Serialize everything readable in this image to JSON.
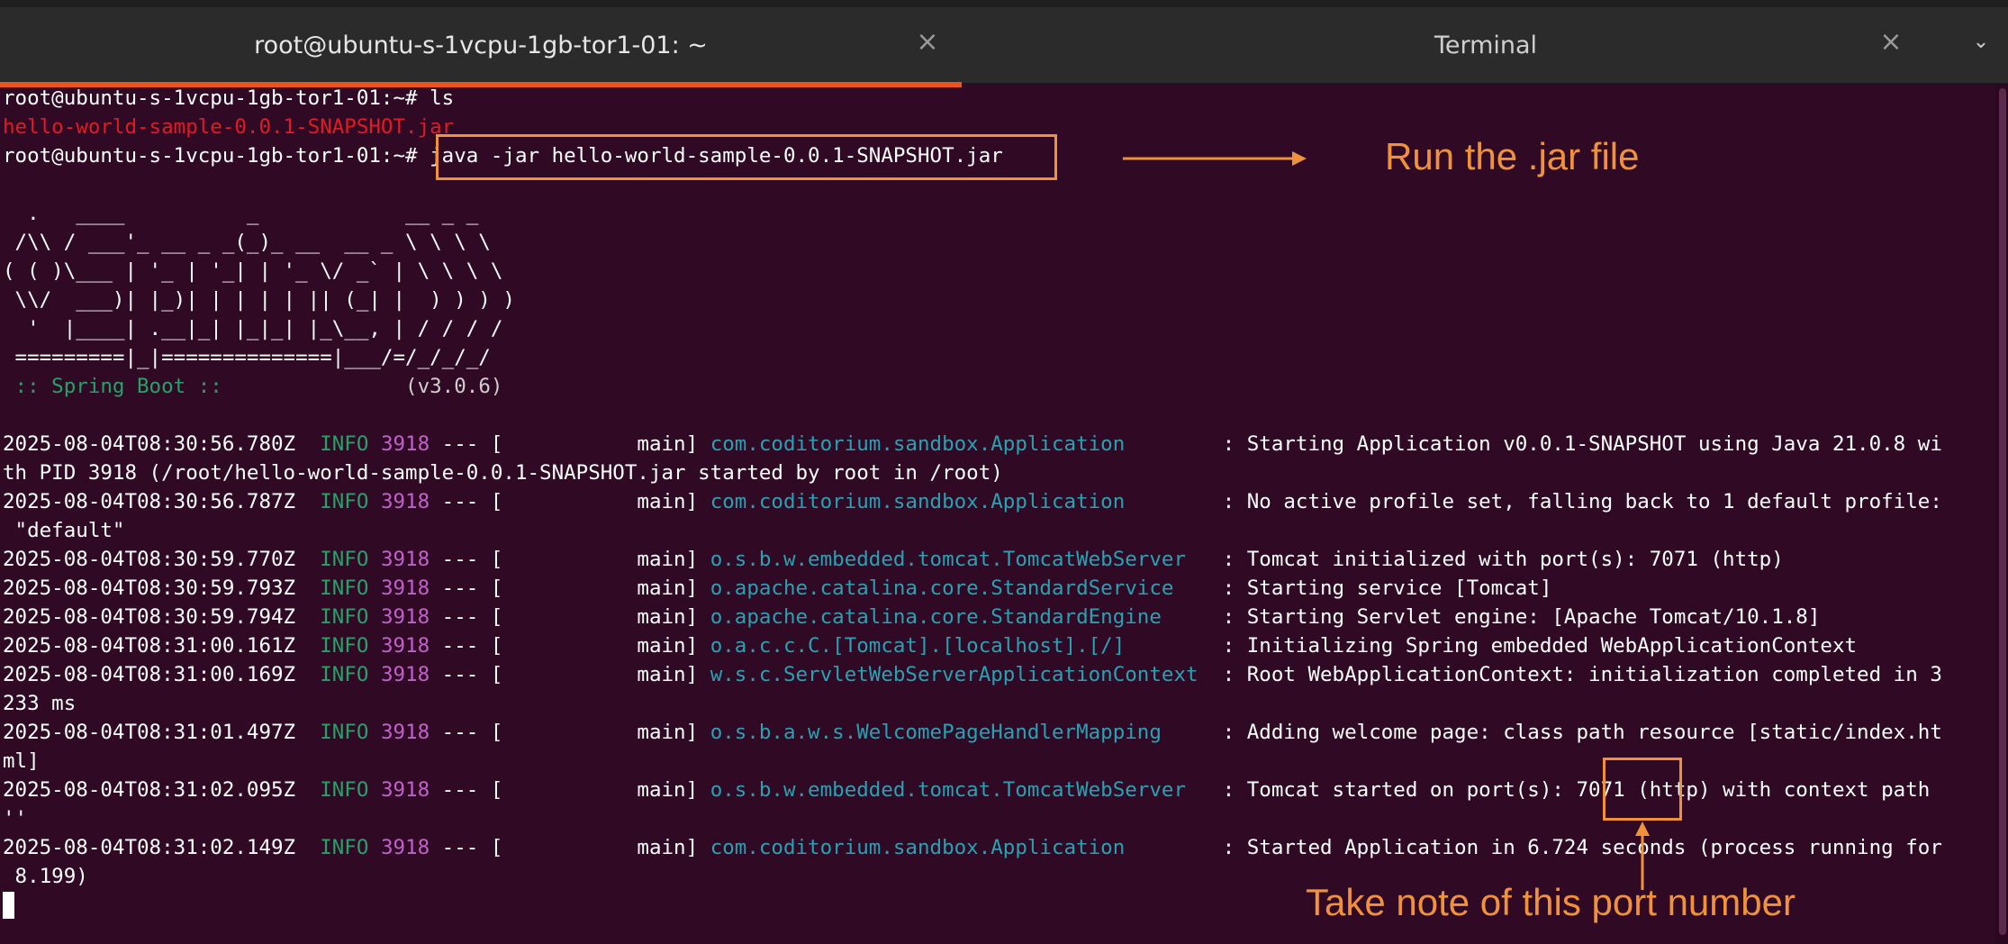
{
  "tabs": [
    {
      "label": "root@ubuntu-s-1vcpu-1gb-tor1-01: ~"
    },
    {
      "label": "Terminal"
    }
  ],
  "icons": {
    "close": "×",
    "menu": "⌄"
  },
  "prompt": "root@ubuntu-s-1vcpu-1gb-tor1-01:~#",
  "cmd1": " ls",
  "ls_output": "hello-world-sample-0.0.1-SNAPSHOT.jar",
  "cmd2": "java -jar hello-world-sample-0.0.1-SNAPSHOT.jar",
  "banner": [
    "  .   ____          _            __ _ _",
    " /\\\\ / ___'_ __ _ _(_)_ __  __ _ \\ \\ \\ \\",
    "( ( )\\___ | '_ | '_| | '_ \\/ _` | \\ \\ \\ \\",
    " \\\\/  ___)| |_)| | | | | || (_| |  ) ) ) )",
    "  '  |____| .__|_| |_|_| |_\\__, | / / / /",
    " =========|_|==============|___/=/_/_/_/"
  ],
  "spring": {
    "label": " :: Spring Boot :: ",
    "version": "              (v3.0.6)"
  },
  "log": {
    "level": "INFO",
    "pid": "3918",
    "sep": " --- [           main] ",
    "entries": [
      {
        "time": "2025-08-04T08:30:56.780Z",
        "logger": "com.coditorium.sandbox.Application       ",
        "msg": " : Starting Application v0.0.1-SNAPSHOT using Java 21.0.8 wi",
        "cont": "th PID 3918 (/root/hello-world-sample-0.0.1-SNAPSHOT.jar started by root in /root)"
      },
      {
        "time": "2025-08-04T08:30:56.787Z",
        "logger": "com.coditorium.sandbox.Application       ",
        "msg": " : No active profile set, falling back to 1 default profile:",
        "cont": " \"default\""
      },
      {
        "time": "2025-08-04T08:30:59.770Z",
        "logger": "o.s.b.w.embedded.tomcat.TomcatWebServer  ",
        "msg": " : Tomcat initialized with port(s): 7071 (http)",
        "cont": ""
      },
      {
        "time": "2025-08-04T08:30:59.793Z",
        "logger": "o.apache.catalina.core.StandardService   ",
        "msg": " : Starting service [Tomcat]",
        "cont": ""
      },
      {
        "time": "2025-08-04T08:30:59.794Z",
        "logger": "o.apache.catalina.core.StandardEngine    ",
        "msg": " : Starting Servlet engine: [Apache Tomcat/10.1.8]",
        "cont": ""
      },
      {
        "time": "2025-08-04T08:31:00.161Z",
        "logger": "o.a.c.c.C.[Tomcat].[localhost].[/]       ",
        "msg": " : Initializing Spring embedded WebApplicationContext",
        "cont": ""
      },
      {
        "time": "2025-08-04T08:31:00.169Z",
        "logger": "w.s.c.ServletWebServerApplicationContext ",
        "msg": " : Root WebApplicationContext: initialization completed in 3",
        "cont": "233 ms"
      },
      {
        "time": "2025-08-04T08:31:01.497Z",
        "logger": "o.s.b.a.w.s.WelcomePageHandlerMapping    ",
        "msg": " : Adding welcome page: class path resource [static/index.ht",
        "cont": "ml]"
      },
      {
        "time": "2025-08-04T08:31:02.095Z",
        "logger": "o.s.b.w.embedded.tomcat.TomcatWebServer  ",
        "msg": " : Tomcat started on port(s): 7071 (http) with context path",
        "cont": "''"
      },
      {
        "time": "2025-08-04T08:31:02.149Z",
        "logger": "com.coditorium.sandbox.Application       ",
        "msg": " : Started Application in 6.724 seconds (process running for",
        "cont": " 8.199)"
      }
    ]
  },
  "annotations": {
    "run_jar": "Run the .jar file",
    "port_note": "Take note of this port number"
  },
  "colors": {
    "accent": "#f0923a",
    "terminal_bg": "#300a24",
    "tab_active": "#e95420"
  }
}
